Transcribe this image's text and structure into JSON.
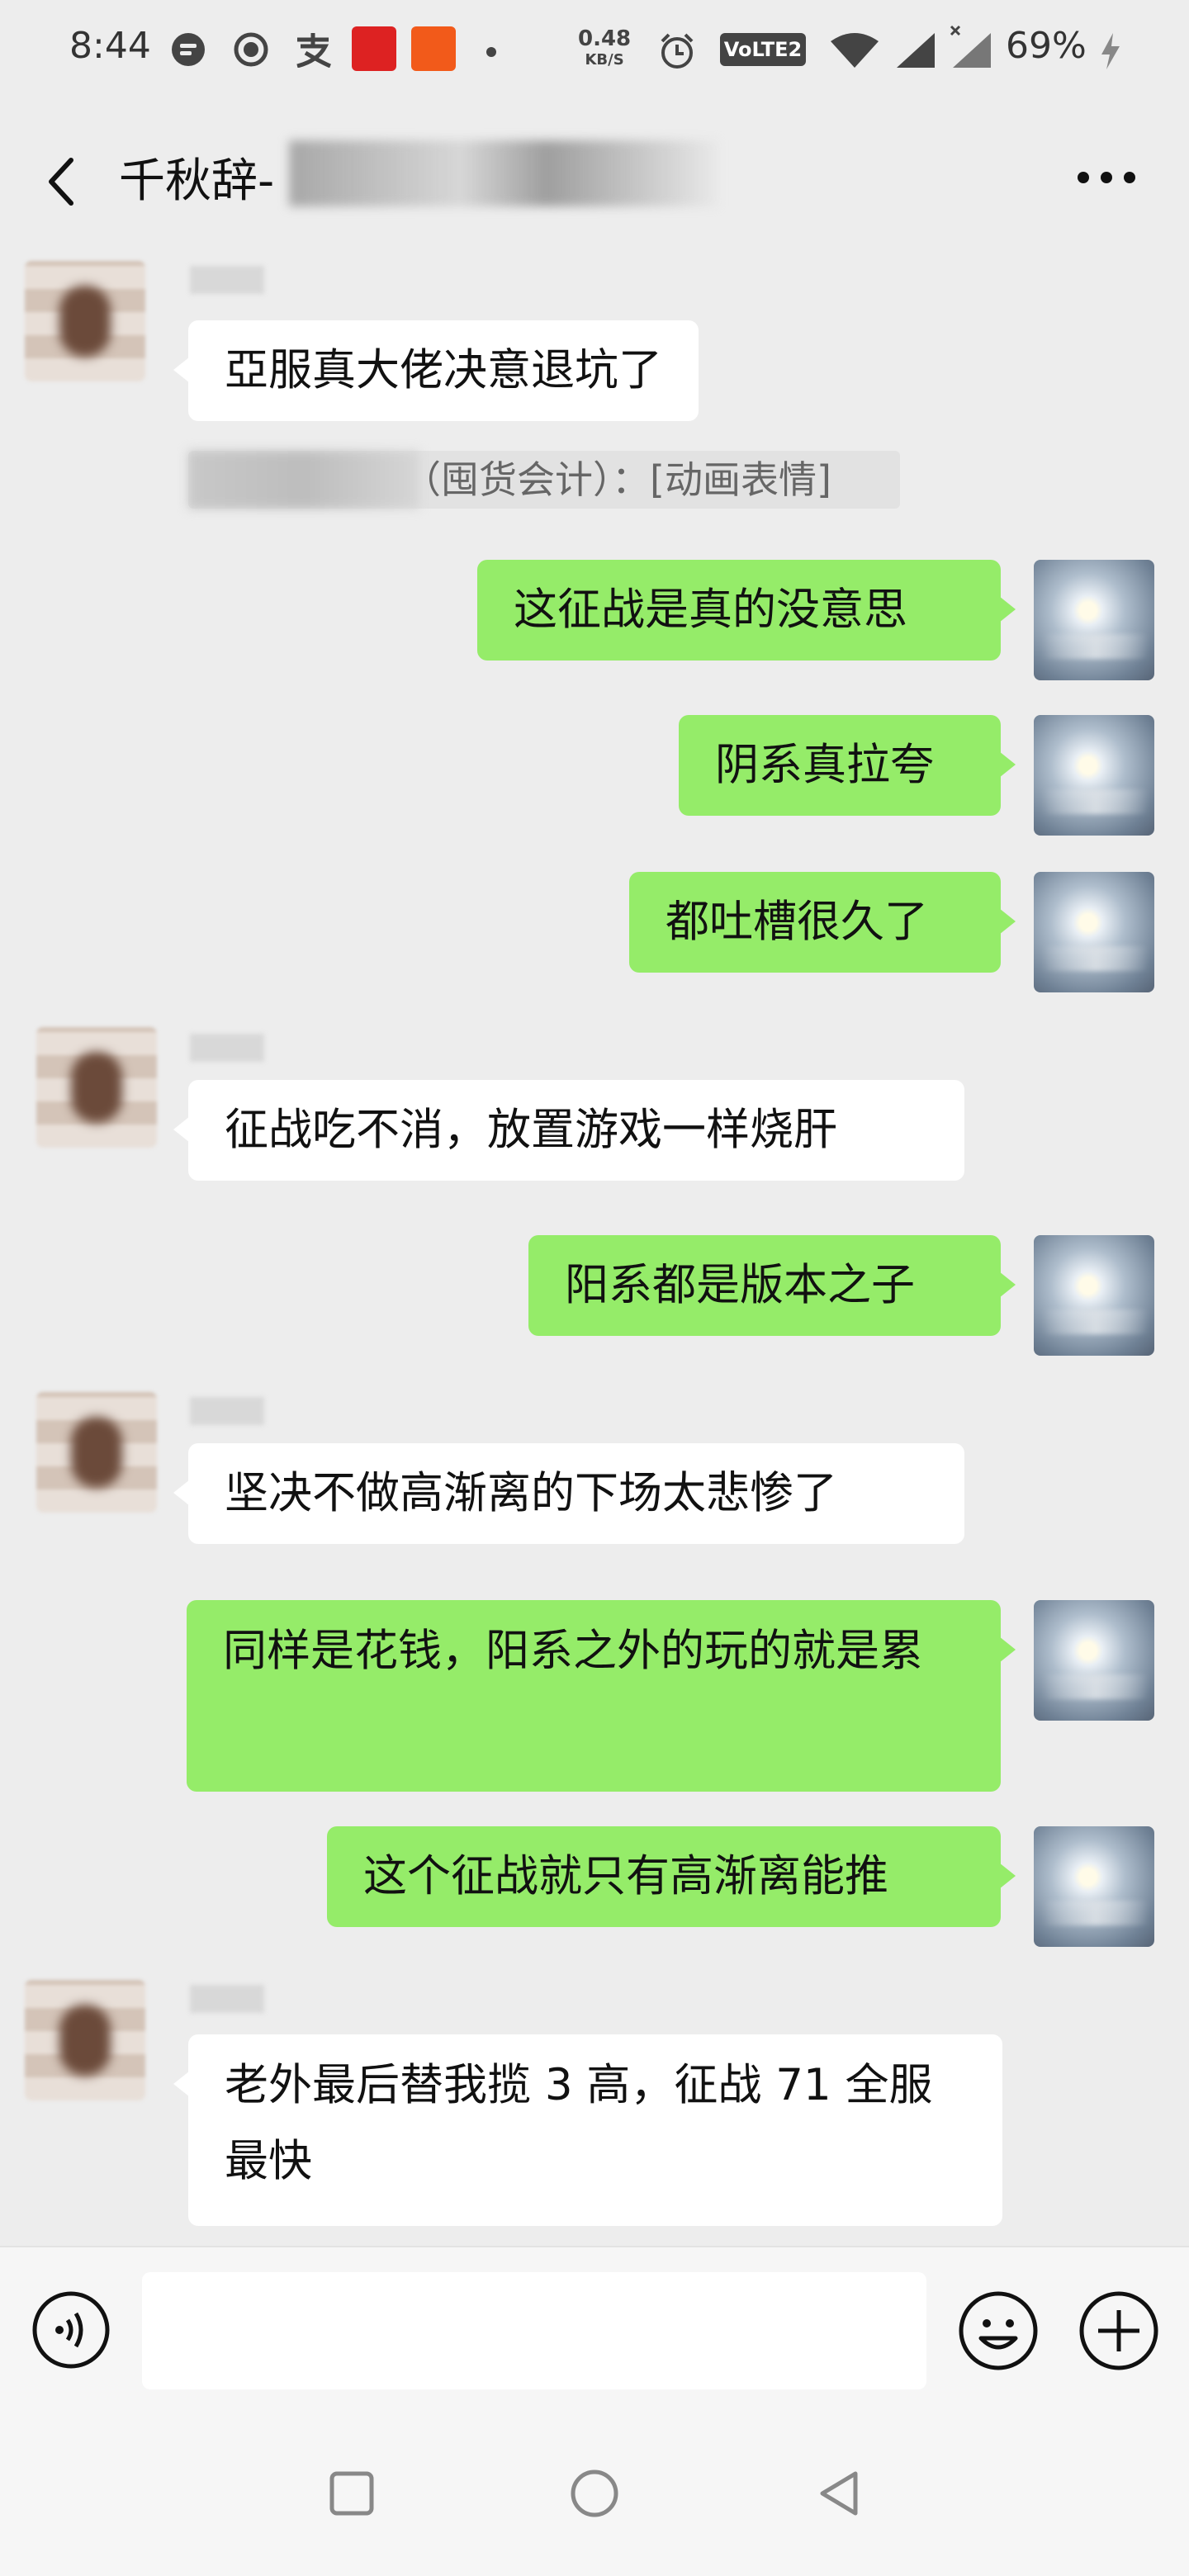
{
  "status_bar": {
    "time": "8:44",
    "speed_value": "0.48",
    "speed_unit": "KB/S",
    "network_badge": "VoLTE2",
    "battery": "69%",
    "icons": [
      "message-bubble-icon",
      "record-icon",
      "alipay-icon",
      "youdao-icon",
      "app-icon",
      "dot-icon",
      "alarm-icon",
      "wifi-icon",
      "signal-icon",
      "signal-x-icon",
      "charging-icon"
    ]
  },
  "header": {
    "title": "千秋辞-",
    "back_icon": "chevron-left-icon",
    "more_icon": "more-dots-icon"
  },
  "messages": [
    {
      "side": "in",
      "text": "亞服真大佬决意退坑了"
    },
    {
      "side": "quote",
      "text": "（囤货会计）：[动画表情]"
    },
    {
      "side": "out",
      "text": "这征战是真的没意思"
    },
    {
      "side": "out",
      "text": "阴系真拉夸"
    },
    {
      "side": "out",
      "text": "都吐槽很久了"
    },
    {
      "side": "in",
      "text": "征战吃不消，放置游戏一样烧肝"
    },
    {
      "side": "out",
      "text": "阳系都是版本之子"
    },
    {
      "side": "in",
      "text": "坚决不做高渐离的下场太悲惨了"
    },
    {
      "side": "out",
      "text": "同样是花钱，阳系之外的玩的就是累"
    },
    {
      "side": "out",
      "text": "这个征战就只有高渐离能推"
    },
    {
      "side": "in",
      "text": "老外最后替我揽 3 高，征战 71 全服最快"
    }
  ],
  "input_bar": {
    "placeholder": "",
    "voice_icon": "voice-icon",
    "emoji_icon": "emoji-icon",
    "plus_icon": "plus-icon"
  },
  "nav_bar": {
    "icons": [
      "recents-square-icon",
      "home-circle-icon",
      "back-triangle-icon"
    ]
  },
  "colors": {
    "background": "#ededed",
    "bubble_out": "#95ec69",
    "bubble_in": "#ffffff"
  }
}
